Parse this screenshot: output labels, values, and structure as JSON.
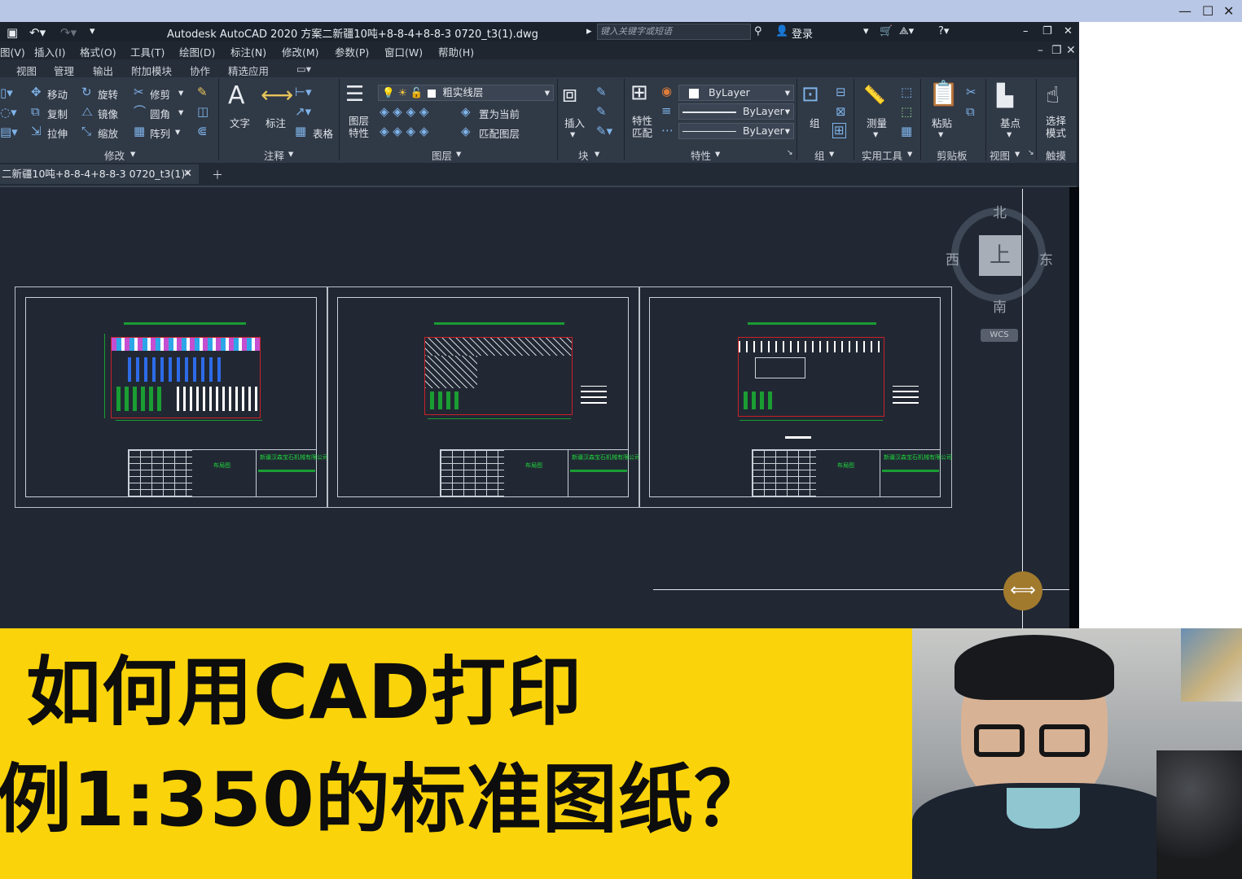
{
  "window": {
    "title": "Autodesk AutoCAD 2020    方案二新疆10吨+8-8-4+8-8-3 0720_t3(1).dwg",
    "search_placeholder": "键入关键字或短语",
    "login": "登录"
  },
  "menu": [
    "图(V)",
    "插入(I)",
    "格式(O)",
    "工具(T)",
    "绘图(D)",
    "标注(N)",
    "修改(M)",
    "参数(P)",
    "窗口(W)",
    "帮助(H)"
  ],
  "ribbon_tabs": [
    "视图",
    "管理",
    "输出",
    "附加模块",
    "协作",
    "精选应用"
  ],
  "ribbon": {
    "modify": {
      "move": "移动",
      "rotate": "旋转",
      "trim": "修剪",
      "copy": "复制",
      "mirror": "镜像",
      "fillet": "圆角",
      "stretch": "拉伸",
      "scale": "缩放",
      "array": "阵列",
      "title": "修改"
    },
    "annotation": {
      "text": "文字",
      "dimension": "标注",
      "table": "表格",
      "title": "注释"
    },
    "layers": {
      "layer_props": "图层\n特性",
      "layer_name": "粗实线层",
      "set_current": "置为当前",
      "match_layer": "匹配图层",
      "title": "图层"
    },
    "block": {
      "insert": "插入",
      "title": "块"
    },
    "properties": {
      "match": "特性\n匹配",
      "color": "ByLayer",
      "linetype": "ByLayer",
      "lineweight": "ByLayer",
      "title": "特性"
    },
    "groups": {
      "group": "组",
      "title": "组"
    },
    "utilities": {
      "measure": "测量",
      "title": "实用工具"
    },
    "clipboard": {
      "paste": "粘贴",
      "title": "剪贴板"
    },
    "view": {
      "base": "基点",
      "title": "视图"
    },
    "touch": {
      "select_mode": "选择\n模式",
      "title": "触摸"
    }
  },
  "document_tab": "二新疆10吨+8-8-4+8-8-3 0720_t3(1)*",
  "viewcube": {
    "north": "北",
    "south": "南",
    "east": "东",
    "west": "西",
    "top": "上",
    "wcs": "WCS"
  },
  "sheets": [
    {
      "title_block_label": "布局图",
      "company": "新疆汉森宝石机械有限公司"
    },
    {
      "title_block_label": "布局图",
      "company": "新疆汉森宝石机械有限公司"
    },
    {
      "title_block_label": "布局图",
      "company": "新疆汉森宝石机械有限公司"
    }
  ],
  "caption": {
    "line1": "如何用CAD打印",
    "line2": "例1:350的标准图纸？"
  },
  "colors": {
    "banner": "#fbd30a",
    "canvas": "#212833",
    "ribbon": "#303946",
    "drawing_green": "#1a9d33",
    "drawing_red": "#c9202a"
  }
}
